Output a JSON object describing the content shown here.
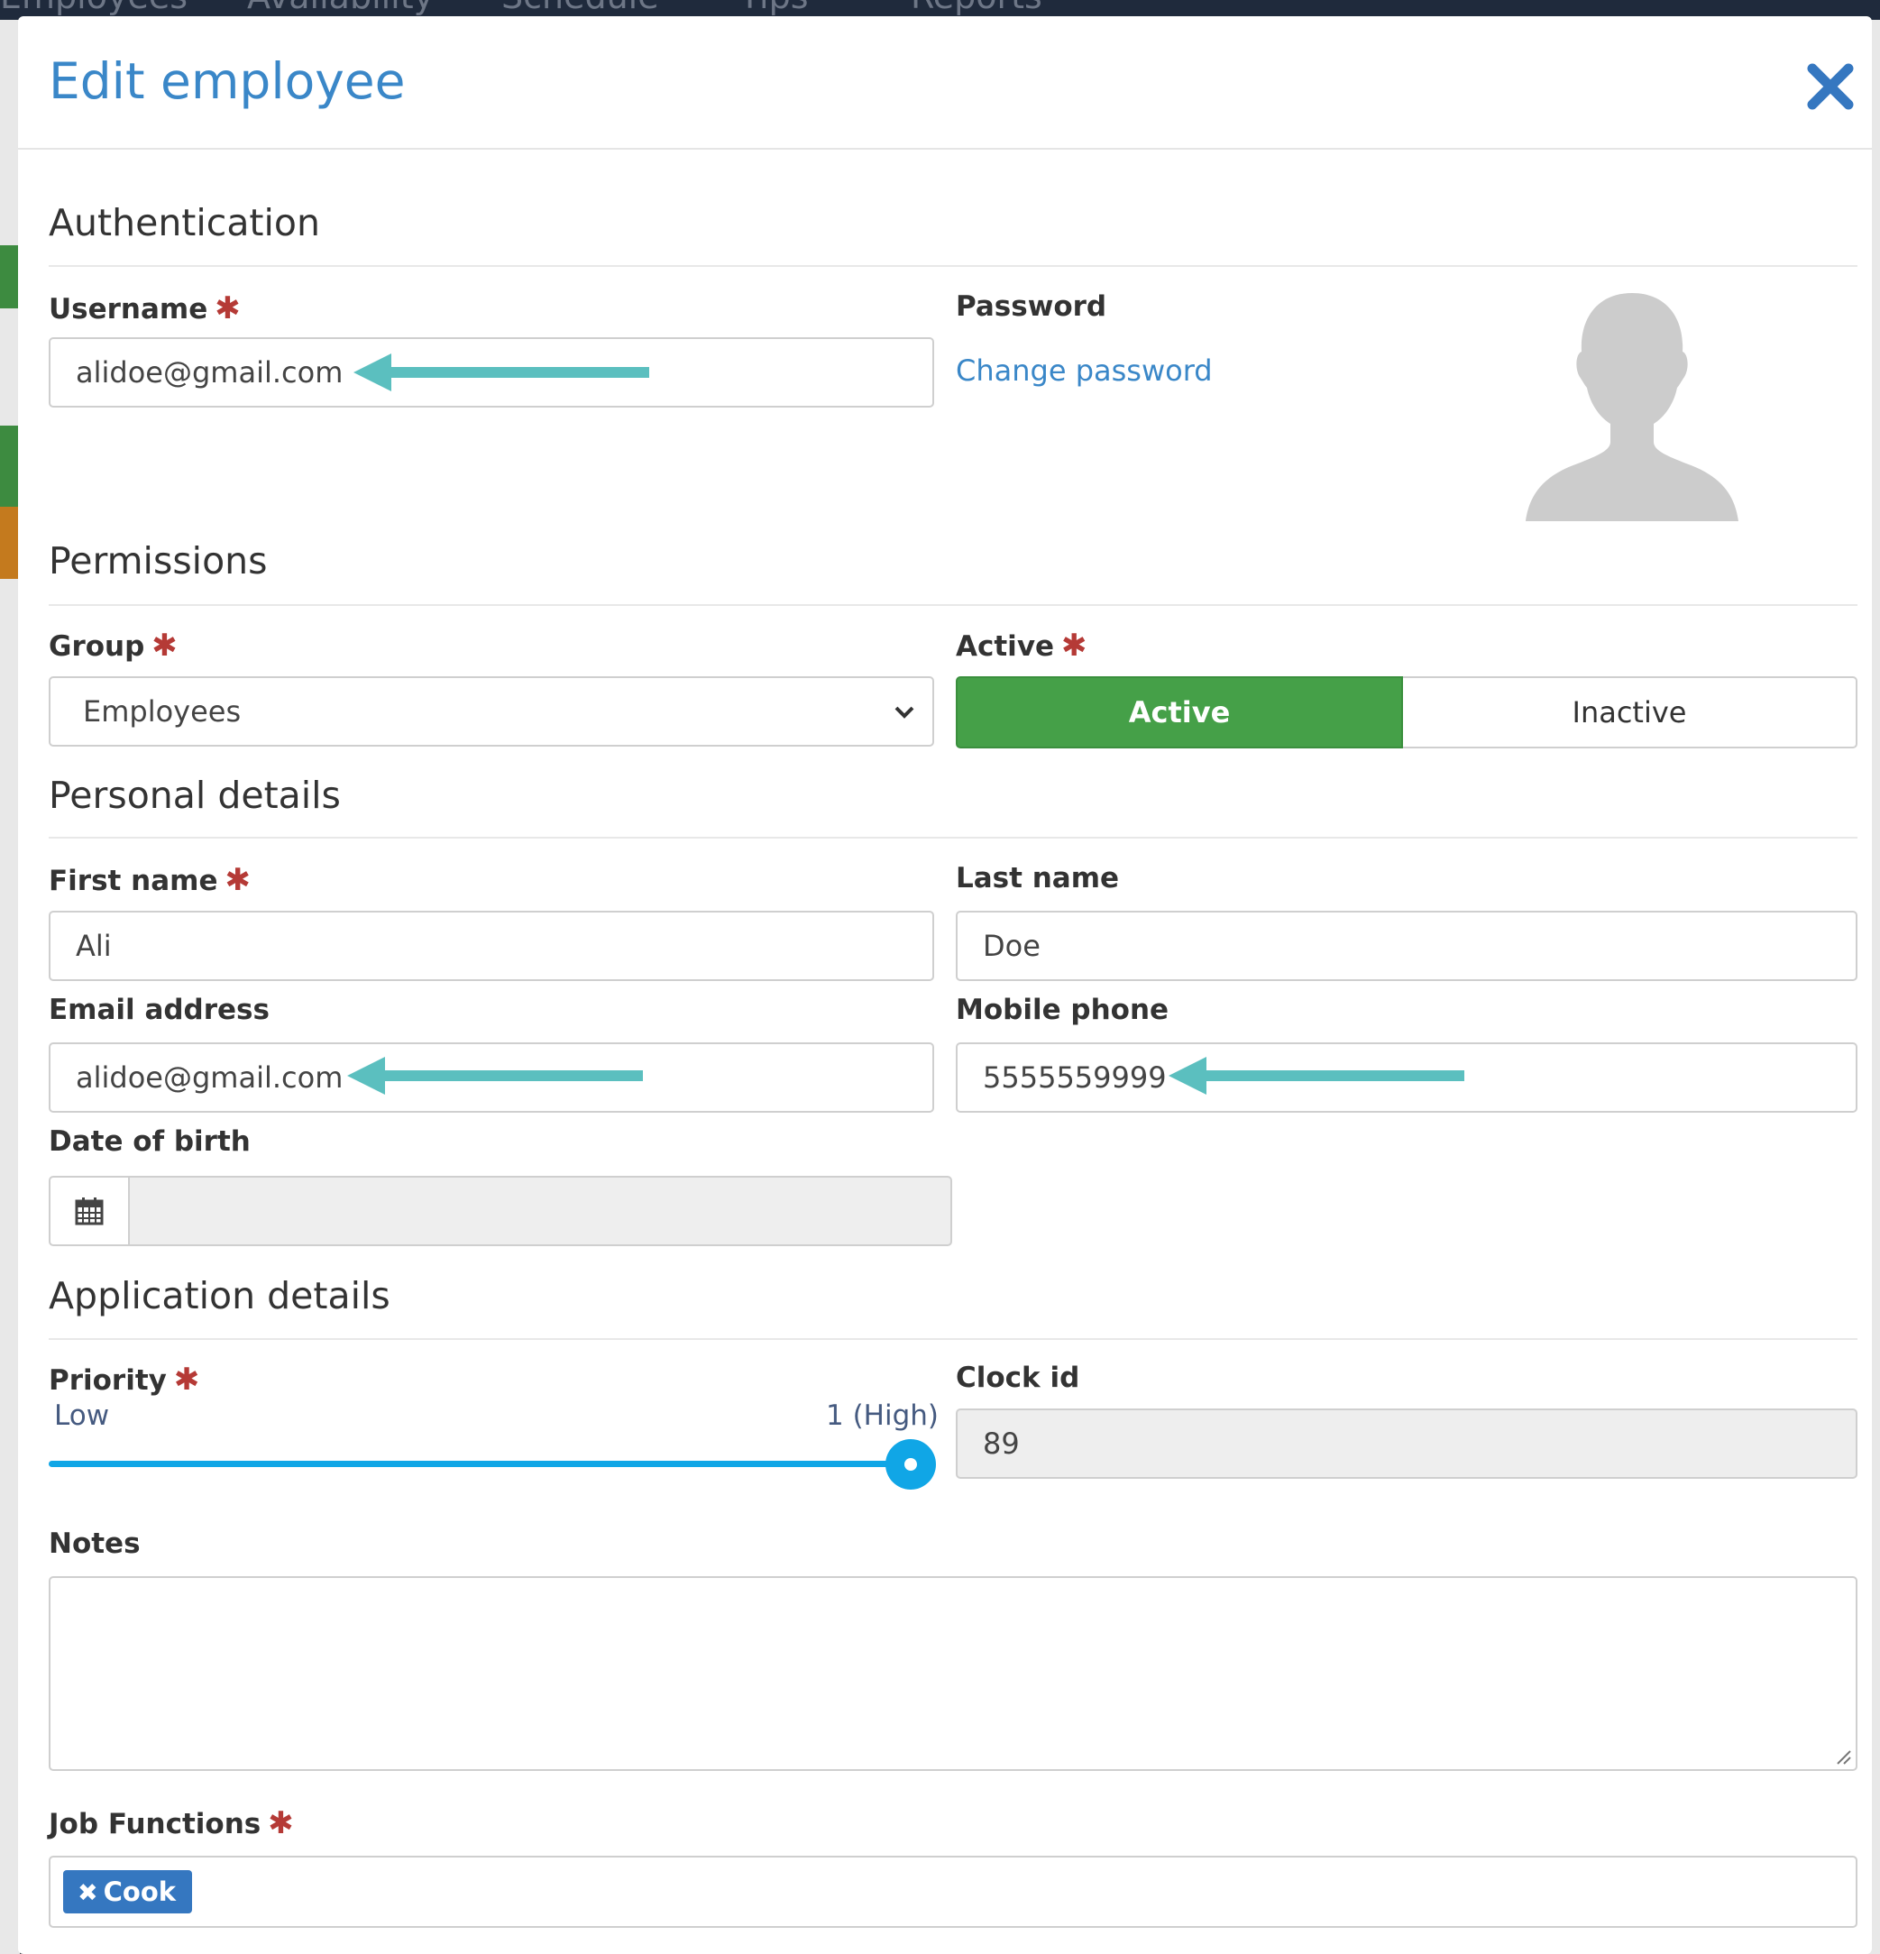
{
  "background_nav": {
    "items": [
      "Employees",
      "Availability",
      "Schedule",
      "Tips",
      "Reports"
    ]
  },
  "modal": {
    "title": "Edit employee",
    "close_icon": "close-icon"
  },
  "authentication": {
    "section_title": "Authentication",
    "username_label": "Username",
    "username_value": "alidoe@gmail.com",
    "password_label": "Password",
    "change_password_link": "Change password",
    "avatar_icon": "user-silhouette-icon"
  },
  "permissions": {
    "section_title": "Permissions",
    "group_label": "Group",
    "group_selected": "Employees",
    "active_label": "Active",
    "active_option": "Active",
    "inactive_option": "Inactive",
    "selected_state": "Active"
  },
  "personal_details": {
    "section_title": "Personal details",
    "first_name_label": "First name",
    "first_name_value": "Ali",
    "last_name_label": "Last name",
    "last_name_value": "Doe",
    "email_label": "Email address",
    "email_value": "alidoe@gmail.com",
    "mobile_label": "Mobile phone",
    "mobile_value": "5555559999",
    "dob_label": "Date of birth",
    "dob_value": "",
    "calendar_icon": "calendar-icon"
  },
  "application_details": {
    "section_title": "Application details",
    "priority_label": "Priority",
    "priority_low": "Low",
    "priority_high": "1 (High)",
    "priority_position": 1.0,
    "clock_id_label": "Clock id",
    "clock_id_value": "89",
    "notes_label": "Notes",
    "notes_value": "",
    "job_functions_label": "Job Functions",
    "job_functions": [
      "Cook"
    ]
  },
  "required_marker": "✱",
  "colors": {
    "title_blue": "#3a87c8",
    "active_green": "#45a048",
    "required_red": "#b53a36",
    "annotation_arrow": "#5bbfbf",
    "slider_blue": "#10a6e6",
    "tag_blue": "#3577c0"
  }
}
